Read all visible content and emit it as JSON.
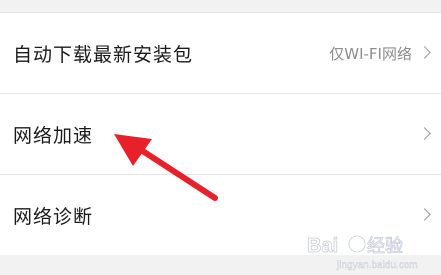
{
  "settings": {
    "rows": [
      {
        "label": "自动下载最新安装包",
        "value": "仅WI-FI网络"
      },
      {
        "label": "网络加速",
        "value": ""
      },
      {
        "label": "网络诊断",
        "value": ""
      }
    ]
  },
  "annotation": {
    "arrow_color": "#e8202a"
  },
  "watermark": {
    "text": "Baidu 经验",
    "url": "jingyan.baidu.com"
  }
}
